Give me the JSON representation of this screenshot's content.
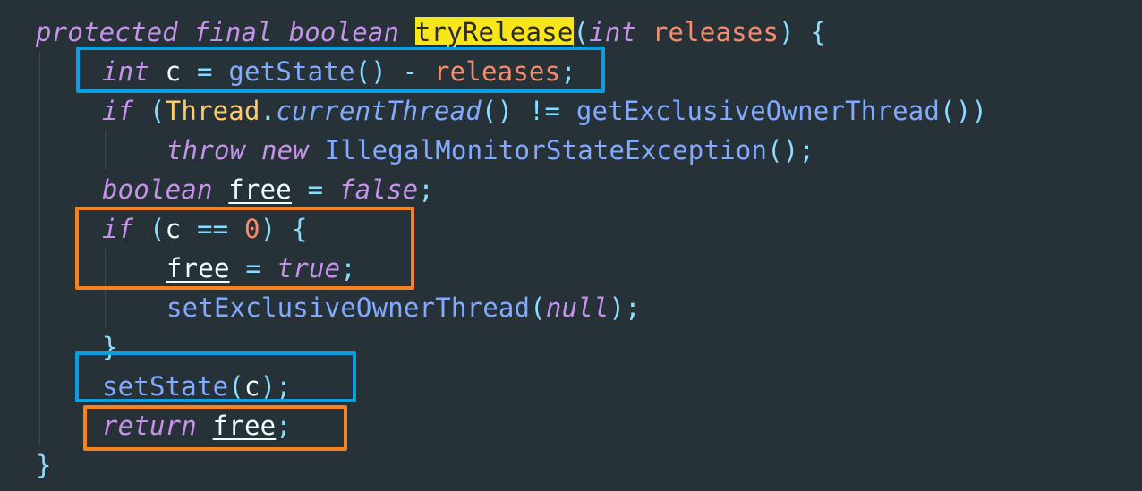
{
  "code": {
    "l1": {
      "kw1": "protected",
      "kw2": "final",
      "kw3": "boolean",
      "method": "tryRelease",
      "p_open": "(",
      "kw4": "int",
      "param": "releases",
      "p_close": ")",
      "brace": "{"
    },
    "l2": {
      "kw": "int",
      "v": "c",
      "eq": "=",
      "fn": "getState",
      "parens": "()",
      "op": "-",
      "param": "releases",
      "semi": ";"
    },
    "l3": {
      "kw": "if",
      "p1": "(",
      "cls": "Thread",
      "dot": ".",
      "m1": "currentThread",
      "pp": "()",
      "op": "!=",
      "m2": "getExclusiveOwnerThread",
      "pp2": "())"
    },
    "l4": {
      "kw1": "throw",
      "kw2": "new",
      "cls": "IllegalMonitorStateException",
      "pp": "()",
      "semi": ";"
    },
    "l5": {
      "kw": "boolean",
      "v": "free",
      "eq": "=",
      "val": "false",
      "semi": ";"
    },
    "l6": {
      "kw": "if",
      "p1": "(",
      "v": "c",
      "op": "==",
      "num": "0",
      "p2": ")",
      "brace": "{"
    },
    "l7": {
      "v": "free",
      "eq": "=",
      "val": "true",
      "semi": ";"
    },
    "l8": {
      "fn": "setExclusiveOwnerThread",
      "p1": "(",
      "val": "null",
      "p2": ")",
      "semi": ";"
    },
    "l9": {
      "brace": "}"
    },
    "l10": {
      "fn": "setState",
      "p1": "(",
      "v": "c",
      "p2": ")",
      "semi": ";"
    },
    "l11": {
      "kw": "return",
      "v": "free",
      "semi": ";"
    },
    "l12": {
      "brace": "}"
    }
  },
  "colors": {
    "background": "#263238",
    "keyword": "#C792EA",
    "function": "#82AAFF",
    "parameter": "#F78C6C",
    "class": "#FFCB6B",
    "punctuation": "#89DDFF",
    "highlight": "#F6E61A",
    "annotation_blue": "#0A9FE3",
    "annotation_orange": "#F58220"
  }
}
